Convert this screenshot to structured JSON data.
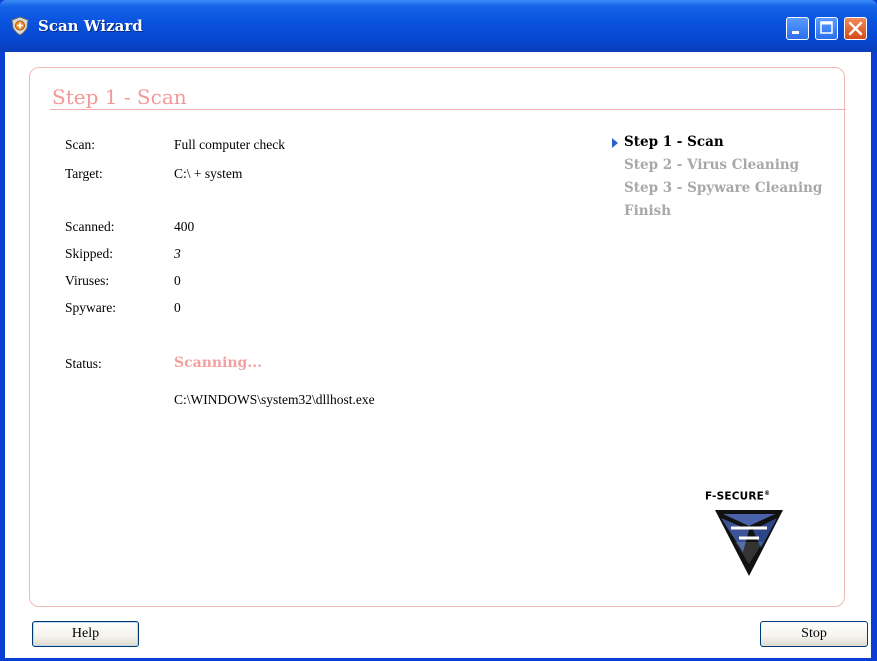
{
  "window": {
    "title": "Scan Wizard",
    "icon": "f-secure-shield-icon",
    "controls": [
      "minimize-icon",
      "maximize-icon",
      "close-icon"
    ]
  },
  "heading": "Step 1 - Scan",
  "scan_info": [
    {
      "label": "Scan:",
      "value": "Full computer check"
    },
    {
      "label": "Target:",
      "value": "C:\\ + system"
    }
  ],
  "stats": [
    {
      "label": "Scanned:",
      "value": "400"
    },
    {
      "label": "Skipped:",
      "value": "3"
    },
    {
      "label": "Viruses:",
      "value": "0"
    },
    {
      "label": "Spyware:",
      "value": "0"
    }
  ],
  "status": {
    "label": "Status:",
    "value": "Scanning...",
    "current_file": "C:\\WINDOWS\\system32\\dllhost.exe"
  },
  "steps": [
    {
      "label": "Step 1 - Scan",
      "active": true
    },
    {
      "label": "Step 2 - Virus Cleaning",
      "active": false
    },
    {
      "label": "Step 3 - Spyware Cleaning",
      "active": false
    },
    {
      "label": "Finish",
      "active": false
    }
  ],
  "brand": {
    "name": "F-SECURE",
    "mark": "®"
  },
  "buttons": {
    "help": "Help",
    "stop": "Stop"
  },
  "colors": {
    "heading": "#f19898",
    "status": "#f4a0a0",
    "inactive_step": "#a8a8a8",
    "titlebar": "#0a54e0"
  }
}
